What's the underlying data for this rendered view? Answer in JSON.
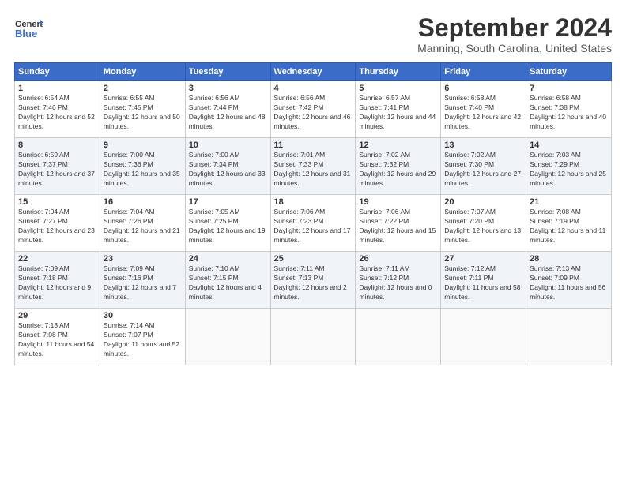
{
  "logo": {
    "line1": "General",
    "line2": "Blue"
  },
  "title": "September 2024",
  "location": "Manning, South Carolina, United States",
  "days_header": [
    "Sunday",
    "Monday",
    "Tuesday",
    "Wednesday",
    "Thursday",
    "Friday",
    "Saturday"
  ],
  "weeks": [
    [
      {
        "day": "1",
        "sunrise": "6:54 AM",
        "sunset": "7:46 PM",
        "daylight": "12 hours and 52 minutes."
      },
      {
        "day": "2",
        "sunrise": "6:55 AM",
        "sunset": "7:45 PM",
        "daylight": "12 hours and 50 minutes."
      },
      {
        "day": "3",
        "sunrise": "6:56 AM",
        "sunset": "7:44 PM",
        "daylight": "12 hours and 48 minutes."
      },
      {
        "day": "4",
        "sunrise": "6:56 AM",
        "sunset": "7:42 PM",
        "daylight": "12 hours and 46 minutes."
      },
      {
        "day": "5",
        "sunrise": "6:57 AM",
        "sunset": "7:41 PM",
        "daylight": "12 hours and 44 minutes."
      },
      {
        "day": "6",
        "sunrise": "6:58 AM",
        "sunset": "7:40 PM",
        "daylight": "12 hours and 42 minutes."
      },
      {
        "day": "7",
        "sunrise": "6:58 AM",
        "sunset": "7:38 PM",
        "daylight": "12 hours and 40 minutes."
      }
    ],
    [
      {
        "day": "8",
        "sunrise": "6:59 AM",
        "sunset": "7:37 PM",
        "daylight": "12 hours and 37 minutes."
      },
      {
        "day": "9",
        "sunrise": "7:00 AM",
        "sunset": "7:36 PM",
        "daylight": "12 hours and 35 minutes."
      },
      {
        "day": "10",
        "sunrise": "7:00 AM",
        "sunset": "7:34 PM",
        "daylight": "12 hours and 33 minutes."
      },
      {
        "day": "11",
        "sunrise": "7:01 AM",
        "sunset": "7:33 PM",
        "daylight": "12 hours and 31 minutes."
      },
      {
        "day": "12",
        "sunrise": "7:02 AM",
        "sunset": "7:32 PM",
        "daylight": "12 hours and 29 minutes."
      },
      {
        "day": "13",
        "sunrise": "7:02 AM",
        "sunset": "7:30 PM",
        "daylight": "12 hours and 27 minutes."
      },
      {
        "day": "14",
        "sunrise": "7:03 AM",
        "sunset": "7:29 PM",
        "daylight": "12 hours and 25 minutes."
      }
    ],
    [
      {
        "day": "15",
        "sunrise": "7:04 AM",
        "sunset": "7:27 PM",
        "daylight": "12 hours and 23 minutes."
      },
      {
        "day": "16",
        "sunrise": "7:04 AM",
        "sunset": "7:26 PM",
        "daylight": "12 hours and 21 minutes."
      },
      {
        "day": "17",
        "sunrise": "7:05 AM",
        "sunset": "7:25 PM",
        "daylight": "12 hours and 19 minutes."
      },
      {
        "day": "18",
        "sunrise": "7:06 AM",
        "sunset": "7:23 PM",
        "daylight": "12 hours and 17 minutes."
      },
      {
        "day": "19",
        "sunrise": "7:06 AM",
        "sunset": "7:22 PM",
        "daylight": "12 hours and 15 minutes."
      },
      {
        "day": "20",
        "sunrise": "7:07 AM",
        "sunset": "7:20 PM",
        "daylight": "12 hours and 13 minutes."
      },
      {
        "day": "21",
        "sunrise": "7:08 AM",
        "sunset": "7:19 PM",
        "daylight": "12 hours and 11 minutes."
      }
    ],
    [
      {
        "day": "22",
        "sunrise": "7:09 AM",
        "sunset": "7:18 PM",
        "daylight": "12 hours and 9 minutes."
      },
      {
        "day": "23",
        "sunrise": "7:09 AM",
        "sunset": "7:16 PM",
        "daylight": "12 hours and 7 minutes."
      },
      {
        "day": "24",
        "sunrise": "7:10 AM",
        "sunset": "7:15 PM",
        "daylight": "12 hours and 4 minutes."
      },
      {
        "day": "25",
        "sunrise": "7:11 AM",
        "sunset": "7:13 PM",
        "daylight": "12 hours and 2 minutes."
      },
      {
        "day": "26",
        "sunrise": "7:11 AM",
        "sunset": "7:12 PM",
        "daylight": "12 hours and 0 minutes."
      },
      {
        "day": "27",
        "sunrise": "7:12 AM",
        "sunset": "7:11 PM",
        "daylight": "11 hours and 58 minutes."
      },
      {
        "day": "28",
        "sunrise": "7:13 AM",
        "sunset": "7:09 PM",
        "daylight": "11 hours and 56 minutes."
      }
    ],
    [
      {
        "day": "29",
        "sunrise": "7:13 AM",
        "sunset": "7:08 PM",
        "daylight": "11 hours and 54 minutes."
      },
      {
        "day": "30",
        "sunrise": "7:14 AM",
        "sunset": "7:07 PM",
        "daylight": "11 hours and 52 minutes."
      },
      null,
      null,
      null,
      null,
      null
    ]
  ]
}
